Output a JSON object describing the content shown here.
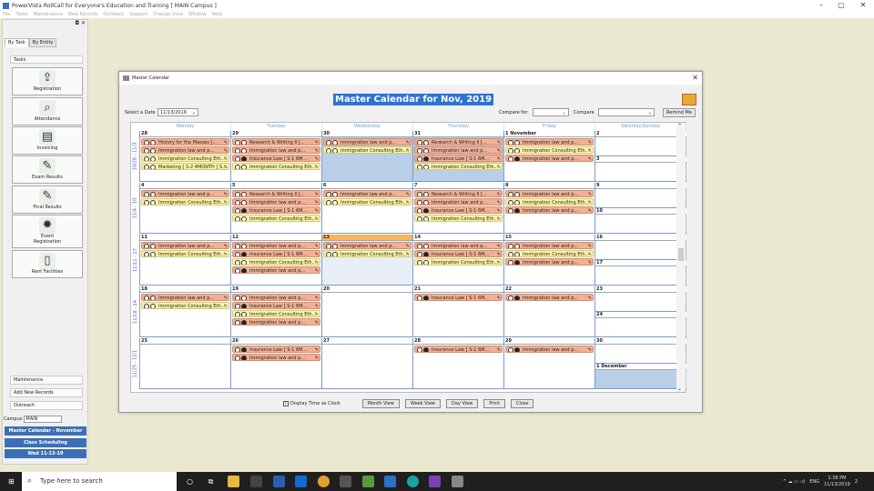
{
  "app": {
    "title": "PowerVista RollCall for Everyone's Education and Training  [ MAIN Campus ]",
    "min": "–",
    "max": "▢",
    "close": "✕"
  },
  "menu": [
    "File",
    "Tasks",
    "Maintenance",
    "New Records",
    "Outreach",
    "Support",
    "Change View",
    "Window",
    "Help"
  ],
  "left": {
    "pin": "◘ ✕",
    "tabs": [
      "By Task",
      "By Entity"
    ],
    "tasks_header": "Tasks",
    "buttons": [
      {
        "label": "Registration",
        "icon": "⇪"
      },
      {
        "label": "Attendance",
        "icon": "⌕"
      },
      {
        "label": "Invoicing",
        "icon": "▤"
      },
      {
        "label": "Exam Results",
        "icon": "✎"
      },
      {
        "label": "Final Results",
        "icon": "✎"
      },
      {
        "label": "Event\nRegistration",
        "icon": "✹"
      },
      {
        "label": "Rent Facilities",
        "icon": "▯"
      }
    ],
    "bottom": [
      "Maintenance",
      "Add New Records",
      "Outreach"
    ],
    "campus_label": "Campus",
    "campus_value": "MAIN",
    "nav": [
      "Master Calendar - November",
      "Class Scheduling",
      "Wed 11-13-19"
    ]
  },
  "win": {
    "title": "Master Calendar",
    "close": "✕",
    "heading": "Master Calendar for Nov, 2019",
    "select_date_label": "Select a Date",
    "select_date_value": "11/13/2019",
    "compare_for_label": "Compare for:",
    "compare_label": "Compare",
    "remind": "Remind Me",
    "days": [
      "Monday",
      "Tuesday",
      "Wednesday",
      "Thursday",
      "Friday",
      "Saturday/Sunday"
    ],
    "display_time": "Display Time as Clock",
    "check": "✓",
    "btns": [
      "Month View",
      "Week View",
      "Day View",
      "Print",
      "Close"
    ]
  },
  "weeks": [
    {
      "label": "10/28 - 11/3",
      "cells": [
        {
          "day": "28",
          "shaded": false,
          "events": [
            {
              "t": "History for the Masses [...",
              "c": "salmon",
              "d": false
            },
            {
              "t": "Immigration law and p...",
              "c": "salmon",
              "d": false
            },
            {
              "t": "Immigration Consulting Eth...",
              "c": "yellow",
              "d": false
            },
            {
              "t": "Marketing [ S-2 4MONTH ] S...",
              "c": "yellow",
              "d": false
            }
          ]
        },
        {
          "day": "29",
          "shaded": false,
          "events": [
            {
              "t": "Research & Writing II [...",
              "c": "salmon",
              "d": false
            },
            {
              "t": "Immigration law and p...",
              "c": "salmon",
              "d": false
            },
            {
              "t": "Insurance Law [ S-1 6M...",
              "c": "salmon",
              "d": true
            },
            {
              "t": "Immigration Consulting Eth...",
              "c": "yellow",
              "d": false
            }
          ]
        },
        {
          "day": "30",
          "shaded": true,
          "events": [
            {
              "t": "Immigration law and p...",
              "c": "salmon",
              "d": false
            },
            {
              "t": "Immigration Consulting Eth...",
              "c": "yellow",
              "d": false
            }
          ]
        },
        {
          "day": "31",
          "shaded": true,
          "events": [
            {
              "t": "Research & Writing II [...",
              "c": "salmon",
              "d": false
            },
            {
              "t": "Immigration law and p...",
              "c": "salmon",
              "d": false
            },
            {
              "t": "Insurance Law [ S-1 6M...",
              "c": "salmon",
              "d": true
            },
            {
              "t": "Immigration Consulting Eth...",
              "c": "yellow",
              "d": false
            }
          ]
        },
        {
          "day": "1 November",
          "shaded": false,
          "events": [
            {
              "t": "Immigration law and p...",
              "c": "salmon",
              "d": false
            },
            {
              "t": "Immigration Consulting Eth...",
              "c": "yellow",
              "d": false
            },
            {
              "t": "Immigration law and p...",
              "c": "salmon",
              "d": true
            }
          ]
        }
      ],
      "sat": "2",
      "sun": "3"
    },
    {
      "label": "11/4 - 10",
      "cells": [
        {
          "day": "4",
          "shaded": false,
          "events": [
            {
              "t": "Immigration law and p...",
              "c": "salmon",
              "d": false
            },
            {
              "t": "Immigration Consulting Eth...",
              "c": "yellow",
              "d": false
            }
          ]
        },
        {
          "day": "5",
          "shaded": false,
          "events": [
            {
              "t": "Research & Writing II [...",
              "c": "salmon",
              "d": false
            },
            {
              "t": "Immigration law and p...",
              "c": "salmon",
              "d": false
            },
            {
              "t": "Insurance Law [ S-1 6M...",
              "c": "salmon",
              "d": true
            },
            {
              "t": "Immigration Consulting Eth...",
              "c": "yellow",
              "d": false
            }
          ]
        },
        {
          "day": "6",
          "shaded": false,
          "events": [
            {
              "t": "Immigration law and p...",
              "c": "salmon",
              "d": false
            },
            {
              "t": "Immigration Consulting Eth...",
              "c": "yellow",
              "d": false
            }
          ]
        },
        {
          "day": "7",
          "shaded": false,
          "events": [
            {
              "t": "Research & Writing II [...",
              "c": "salmon",
              "d": false
            },
            {
              "t": "Immigration law and p...",
              "c": "salmon",
              "d": false
            },
            {
              "t": "Insurance Law [ S-1 6M...",
              "c": "salmon",
              "d": true
            },
            {
              "t": "Immigration Consulting Eth...",
              "c": "yellow",
              "d": false
            }
          ]
        },
        {
          "day": "8",
          "shaded": false,
          "events": [
            {
              "t": "Immigration law and p...",
              "c": "salmon",
              "d": false
            },
            {
              "t": "Immigration Consulting Eth...",
              "c": "yellow",
              "d": false
            },
            {
              "t": "Immigration law and p...",
              "c": "salmon",
              "d": true
            }
          ]
        }
      ],
      "sat": "9",
      "sun": "10"
    },
    {
      "label": "11/11 - 17",
      "cells": [
        {
          "day": "11",
          "shaded": false,
          "events": [
            {
              "t": "Immigration law and p...",
              "c": "salmon",
              "d": false
            },
            {
              "t": "Immigration Consulting Eth...",
              "c": "yellow",
              "d": false
            }
          ]
        },
        {
          "day": "12",
          "shaded": false,
          "events": [
            {
              "t": "Immigration law and p...",
              "c": "salmon",
              "d": false
            },
            {
              "t": "Insurance Law [ S-1 6M...",
              "c": "salmon",
              "d": true
            },
            {
              "t": "Immigration Consulting Eth...",
              "c": "yellow",
              "d": false
            },
            {
              "t": "Immigration law and p...",
              "c": "salmon",
              "d": true
            }
          ]
        },
        {
          "day": "13",
          "shaded": false,
          "today": true,
          "events": [
            {
              "t": "Immigration law and p...",
              "c": "salmon",
              "d": false
            },
            {
              "t": "Immigration Consulting Eth...",
              "c": "yellow",
              "d": false
            }
          ]
        },
        {
          "day": "14",
          "shaded": false,
          "events": [
            {
              "t": "Immigration law and p...",
              "c": "salmon",
              "d": false
            },
            {
              "t": "Insurance Law [ S-1 6M...",
              "c": "salmon",
              "d": true
            },
            {
              "t": "Immigration Consulting Eth...",
              "c": "yellow",
              "d": false
            }
          ]
        },
        {
          "day": "15",
          "shaded": false,
          "events": [
            {
              "t": "Immigration law and p...",
              "c": "salmon",
              "d": false
            },
            {
              "t": "Immigration Consulting Eth...",
              "c": "yellow",
              "d": false
            },
            {
              "t": "Immigration law and p...",
              "c": "salmon",
              "d": true
            }
          ]
        }
      ],
      "sat": "16",
      "sun": "17"
    },
    {
      "label": "11/18 - 24",
      "cells": [
        {
          "day": "18",
          "shaded": false,
          "events": [
            {
              "t": "Immigration law and p...",
              "c": "salmon",
              "d": false
            },
            {
              "t": "Immigration Consulting Eth...",
              "c": "yellow",
              "d": false
            }
          ]
        },
        {
          "day": "19",
          "shaded": false,
          "events": [
            {
              "t": "Immigration law and p...",
              "c": "salmon",
              "d": false
            },
            {
              "t": "Insurance Law [ S-1 6M...",
              "c": "salmon",
              "d": true
            },
            {
              "t": "Immigration Consulting Eth...",
              "c": "yellow",
              "d": false
            },
            {
              "t": "Immigration law and p...",
              "c": "salmon",
              "d": true
            }
          ]
        },
        {
          "day": "20",
          "shaded": false,
          "events": []
        },
        {
          "day": "21",
          "shaded": false,
          "events": [
            {
              "t": "Insurance Law [ S-1 6M...",
              "c": "salmon",
              "d": true
            }
          ]
        },
        {
          "day": "22",
          "shaded": false,
          "events": [
            {
              "t": "Immigration law and p...",
              "c": "salmon",
              "d": true
            }
          ]
        }
      ],
      "sat": "23",
      "sun": "24"
    },
    {
      "label": "11/25 - 12/1",
      "cells": [
        {
          "day": "25",
          "shaded": false,
          "events": []
        },
        {
          "day": "26",
          "shaded": false,
          "events": [
            {
              "t": "Insurance Law [ S-1 6M...",
              "c": "salmon",
              "d": true
            },
            {
              "t": "Immigration law and p...",
              "c": "salmon",
              "d": true
            }
          ]
        },
        {
          "day": "27",
          "shaded": false,
          "events": []
        },
        {
          "day": "28",
          "shaded": false,
          "events": [
            {
              "t": "Insurance Law [ S-1 6M...",
              "c": "salmon",
              "d": true
            }
          ]
        },
        {
          "day": "29",
          "shaded": false,
          "events": [
            {
              "t": "Immigration law and p...",
              "c": "salmon",
              "d": true
            }
          ]
        }
      ],
      "sat": "30",
      "sun": "1 December",
      "sun_shaded": true
    }
  ],
  "taskbar": {
    "search": "Type here to search",
    "lang": "ENG",
    "time": "1:38 PM",
    "date": "11/13/2019",
    "notif": "2",
    "tray": "^ ☁ ▭ ◁)"
  }
}
